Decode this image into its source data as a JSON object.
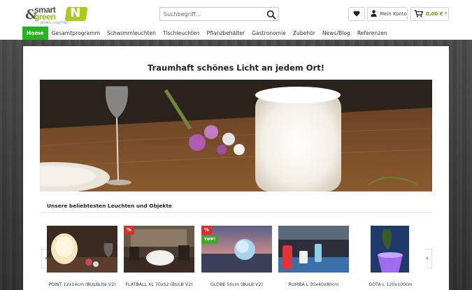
{
  "brand": {
    "amp": "&",
    "word1": "smart",
    "word2": "green",
    "tagline": "BRING LIGHTING",
    "badge": "N"
  },
  "search": {
    "placeholder": "Suchbegriff..."
  },
  "header": {
    "account_label": "Mein Konto",
    "cart_amount": "0,00 € *"
  },
  "nav": {
    "items": [
      {
        "label": "Home"
      },
      {
        "label": "Gesamtprogramm"
      },
      {
        "label": "Schwimmleuchten"
      },
      {
        "label": "Tischleuchten"
      },
      {
        "label": "Pflanzbehälter"
      },
      {
        "label": "Gastronomie"
      },
      {
        "label": "Zubehör"
      },
      {
        "label": "News/Blog"
      },
      {
        "label": "Referenzen"
      }
    ]
  },
  "main": {
    "headline": "Traumhaft schönes Licht an jedem Ort!",
    "section_title": "Unsere beliebtesten Leuchten und Objekte"
  },
  "slider": {
    "prev": "‹",
    "next": "›"
  },
  "products": [
    {
      "name": "POINT 12x14cm (BULBLite V2)",
      "badge": "",
      "tip": ""
    },
    {
      "name": "FLATBALL XL 70x52 (BULB V2)",
      "badge": "%",
      "tip": ""
    },
    {
      "name": "GLOBE 50cm (BULB V2)",
      "badge": "%",
      "tip": "TIPP!"
    },
    {
      "name": "RUMBA L 30x40x80cm",
      "badge": "",
      "tip": ""
    },
    {
      "name": "GOTA L 120x100cm",
      "badge": "",
      "tip": ""
    }
  ],
  "colors": {
    "accent_green": "#27b21f",
    "sale_red": "#d9302a",
    "price_green": "#5a9e0a"
  }
}
